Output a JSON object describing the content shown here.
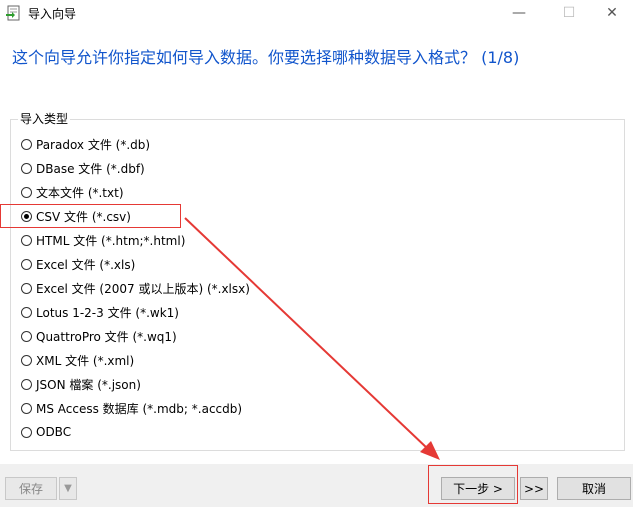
{
  "window": {
    "title": "导入向导",
    "minimize_glyph": "—",
    "maximize_glyph": "☐",
    "close_glyph": "✕"
  },
  "heading": "这个向导允许你指定如何导入数据。你要选择哪种数据导入格式？ (1/8)",
  "import_type": {
    "group_label": "导入类型",
    "selected": "CSV 文件 (*.csv)",
    "options": [
      {
        "label": "Paradox 文件 (*.db)"
      },
      {
        "label": "DBase 文件 (*.dbf)"
      },
      {
        "label": "文本文件 (*.txt)"
      },
      {
        "label": "CSV 文件 (*.csv)"
      },
      {
        "label": "HTML 文件 (*.htm;*.html)"
      },
      {
        "label": "Excel 文件 (*.xls)"
      },
      {
        "label": "Excel 文件 (2007 或以上版本) (*.xlsx)"
      },
      {
        "label": "Lotus 1-2-3 文件 (*.wk1)"
      },
      {
        "label": "QuattroPro 文件 (*.wq1)"
      },
      {
        "label": "XML 文件 (*.xml)"
      },
      {
        "label": "JSON 檔案 (*.json)"
      },
      {
        "label": "MS Access 数据库 (*.mdb; *.accdb)"
      },
      {
        "label": "ODBC"
      }
    ]
  },
  "buttons": {
    "save": "保存",
    "save_dropdown": "▼",
    "next": "下一步 >",
    "finish": ">>",
    "cancel": "取消"
  },
  "colors": {
    "heading": "#1155cc",
    "annotation": "#e53935"
  },
  "icons": {
    "app": "import-wizard-icon",
    "annotation_arrow": "red-arrow-icon"
  }
}
